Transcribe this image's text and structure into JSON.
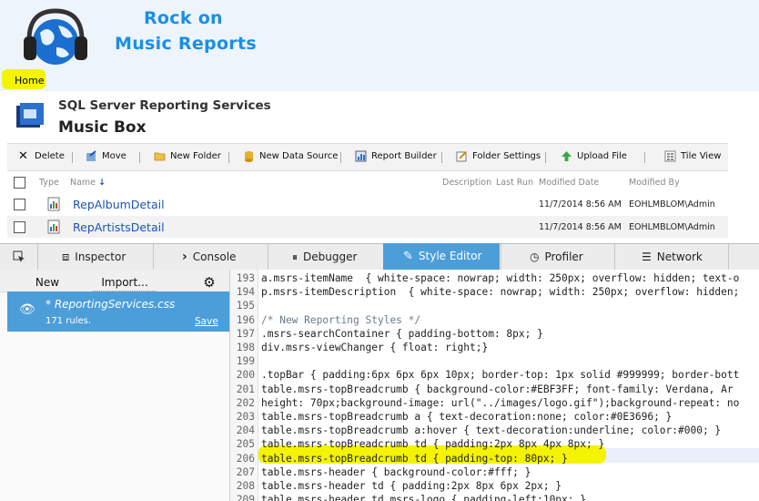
{
  "brand": {
    "line1": "Rock on",
    "line2": "Music Reports"
  },
  "breadcrumb": {
    "home": "Home"
  },
  "ssrs": {
    "product": "SQL Server Reporting Services",
    "folder": "Music Box"
  },
  "toolbar": {
    "delete": "Delete",
    "move": "Move",
    "new_folder": "New Folder",
    "new_data_source": "New Data Source",
    "report_builder": "Report Builder",
    "folder_settings": "Folder Settings",
    "upload_file": "Upload File",
    "tile_view": "Tile View"
  },
  "list": {
    "headers": {
      "type": "Type",
      "name": "Name",
      "description": "Description",
      "last_run": "Last Run",
      "modified_date": "Modified Date",
      "modified_by": "Modified By"
    },
    "rows": [
      {
        "name": "RepAlbumDetail",
        "date": "11/7/2014 8:56 AM",
        "by": "EOHLMBLOM\\Admin"
      },
      {
        "name": "RepArtistsDetail",
        "date": "11/7/2014 8:56 AM",
        "by": "EOHLMBLOM\\Admin"
      }
    ]
  },
  "devtools": {
    "tabs": {
      "inspector": "Inspector",
      "console": "Console",
      "debugger": "Debugger",
      "style_editor": "Style Editor",
      "profiler": "Profiler",
      "network": "Network"
    },
    "sidebar": {
      "new": "New",
      "import": "Import...",
      "sheet_name": "* ReportingServices.css",
      "rules": "171 rules.",
      "save": "Save"
    },
    "code": [
      {
        "n": "193",
        "t": "a.msrs-itemName  { white-space: nowrap; width: 250px; overflow: hidden; text-o"
      },
      {
        "n": "194",
        "t": "p.msrs-itemDescription  { white-space: nowrap; width: 250px; overflow: hidden;"
      },
      {
        "n": "195",
        "t": ""
      },
      {
        "n": "196",
        "t": "/* New Reporting Styles */"
      },
      {
        "n": "197",
        "t": ".msrs-searchContainer { padding-bottom: 8px; }"
      },
      {
        "n": "198",
        "t": "div.msrs-viewChanger { float: right;}"
      },
      {
        "n": "199",
        "t": ""
      },
      {
        "n": "200",
        "t": ".topBar { padding:6px 6px 6px 10px; border-top: 1px solid #999999; border-bott"
      },
      {
        "n": "201",
        "t": "table.msrs-topBreadcrumb { background-color:#EBF3FF; font-family: Verdana, Ar"
      },
      {
        "n": "202",
        "t": "height: 70px;background-image: url(\"../images/logo.gif\");background-repeat: no"
      },
      {
        "n": "203",
        "t": "table.msrs-topBreadcrumb a { text-decoration:none; color:#0E3696; }"
      },
      {
        "n": "204",
        "t": "table.msrs-topBreadcrumb a:hover { text-decoration:underline; color:#000; }"
      },
      {
        "n": "205",
        "t": "table.msrs-topBreadcrumb td { padding:2px 8px 4px 8px; }"
      },
      {
        "n": "206",
        "t": "table.msrs-topBreadcrumb td { padding-top: 80px; }"
      },
      {
        "n": "207",
        "t": "table.msrs-header { background-color:#fff; }"
      },
      {
        "n": "208",
        "t": "table.msrs-header td { padding:2px 8px 6px 2px; }"
      },
      {
        "n": "209",
        "t": "table.msrs-header td.msrs-logo { padding-left:10px; }"
      }
    ]
  }
}
